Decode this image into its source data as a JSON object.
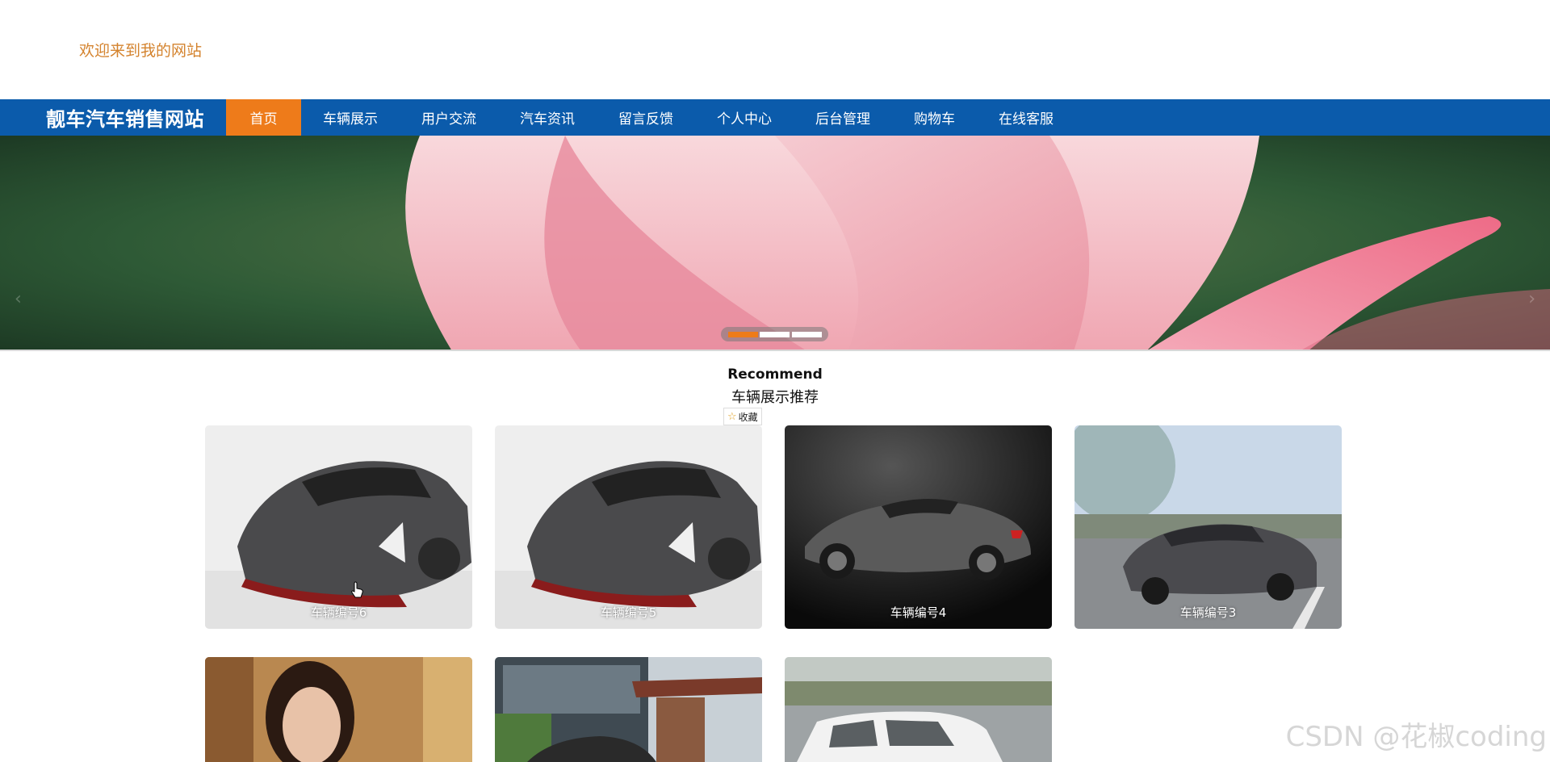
{
  "header": {
    "welcome": "欢迎来到我的网站"
  },
  "nav": {
    "brand": "靓车汽车销售网站",
    "items": [
      {
        "label": "首页",
        "active": true
      },
      {
        "label": "车辆展示"
      },
      {
        "label": "用户交流"
      },
      {
        "label": "汽车资讯"
      },
      {
        "label": "留言反馈"
      },
      {
        "label": "个人中心"
      },
      {
        "label": "后台管理"
      },
      {
        "label": "购物车"
      },
      {
        "label": "在线客服"
      }
    ]
  },
  "banner": {
    "slides": 3,
    "active_index": 0,
    "arrows": [
      "‹",
      "›"
    ]
  },
  "recommend": {
    "title": "Recommend",
    "subtitle": "车辆展示推荐",
    "favorite_label": "收藏",
    "cards": [
      {
        "caption": "车辆编号6",
        "icon": "supercar-image"
      },
      {
        "caption": "车辆编号5",
        "icon": "supercar-image"
      },
      {
        "caption": "车辆编号4",
        "icon": "concept-car-image"
      },
      {
        "caption": "车辆编号3",
        "icon": "sedan-image"
      },
      {
        "caption": "",
        "icon": "portrait-image"
      },
      {
        "caption": "",
        "icon": "building-car-image"
      },
      {
        "caption": "",
        "icon": "white-car-image"
      }
    ]
  },
  "watermark": "CSDN @花椒coding",
  "colors": {
    "nav_bg": "#0b5bab",
    "accent": "#ee7b1a",
    "welcome": "#d4832e"
  }
}
